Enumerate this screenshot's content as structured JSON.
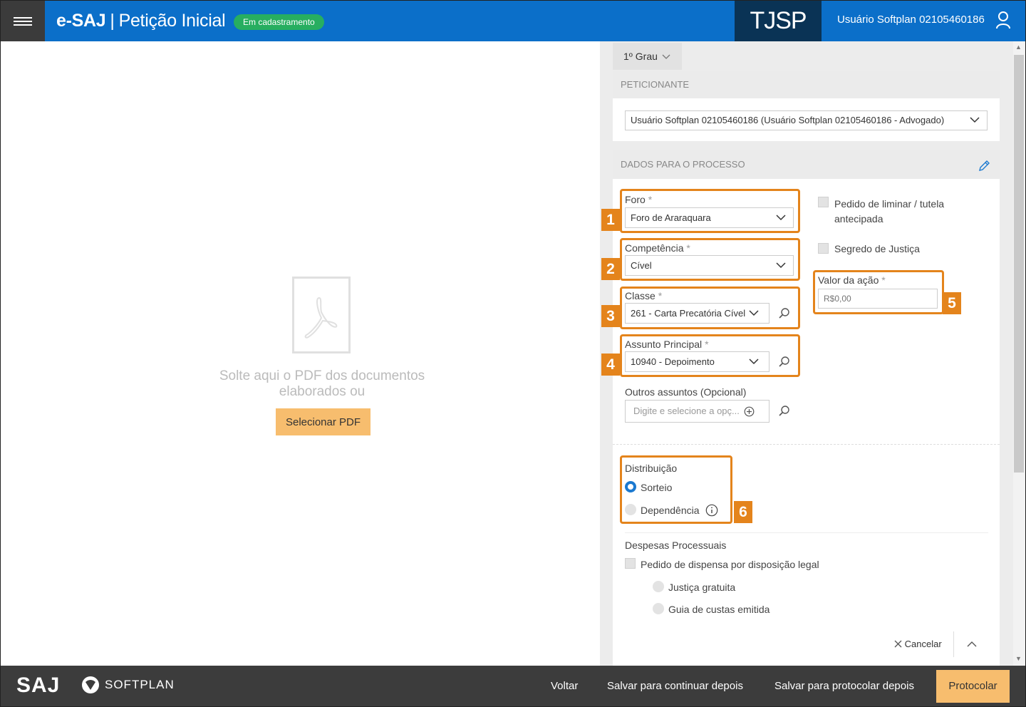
{
  "header": {
    "app_name": "e-SAJ",
    "separator": "|",
    "page_title": "Petição Inicial",
    "status": "Em cadastramento",
    "court": "TJSP",
    "user": "Usuário Softplan 02105460186"
  },
  "pdf_area": {
    "drop_text": "Solte aqui o PDF dos documentos elaborados ou",
    "select_button": "Selecionar PDF"
  },
  "form": {
    "grau": "1º Grau",
    "peticionante": {
      "section": "PETICIONANTE",
      "value": "Usuário Softplan 02105460186 (Usuário Softplan 02105460186 - Advogado)"
    },
    "dados": {
      "section": "DADOS PARA O PROCESSO",
      "foro_label": "Foro",
      "foro_value": "Foro de Araraquara",
      "competencia_label": "Competência",
      "competencia_value": "Cível",
      "classe_label": "Classe",
      "classe_value": "261 - Carta Precatória Cível",
      "assunto_label": "Assunto Principal",
      "assunto_value": "10940 - Depoimento",
      "outros_label": "Outros assuntos (Opcional)",
      "outros_placeholder": "Digite e selecione a opç...",
      "liminar_label_1": "Pedido de liminar / tutela",
      "liminar_label_2": "antecipada",
      "segredo_label": "Segredo de Justiça",
      "valor_label": "Valor da ação",
      "valor_placeholder": "R$0,00",
      "required_mark": "*"
    },
    "distribuicao": {
      "label": "Distribuição",
      "sorteio": "Sorteio",
      "dependencia": "Dependência",
      "selected": "Sorteio"
    },
    "despesas": {
      "label": "Despesas Processuais",
      "dispensa": "Pedido de dispensa por disposição legal",
      "justica_gratuita": "Justiça gratuita",
      "guia": "Guia de custas emitida"
    },
    "cancel": "Cancelar"
  },
  "callouts": [
    "1",
    "2",
    "3",
    "4",
    "5",
    "6"
  ],
  "footer": {
    "saj": "SAJ",
    "softplan": "SOFTPLAN",
    "voltar": "Voltar",
    "salvar_continuar": "Salvar para continuar depois",
    "salvar_protocolar": "Salvar para protocolar depois",
    "protocolar": "Protocolar"
  },
  "colors": {
    "header_blue": "#0b6fc9",
    "court_navy": "#0a3355",
    "badge_green": "#27ae60",
    "highlight_orange": "#e4841c",
    "button_orange": "#f7bd6e",
    "footer_dark": "#3c3c3c"
  },
  "icons": [
    "menu-icon",
    "user-icon",
    "pdf-icon",
    "chevron-down-icon",
    "search-icon",
    "add-icon",
    "pencil-icon",
    "info-icon",
    "close-icon",
    "chevron-up-icon",
    "softplan-logo-icon"
  ]
}
